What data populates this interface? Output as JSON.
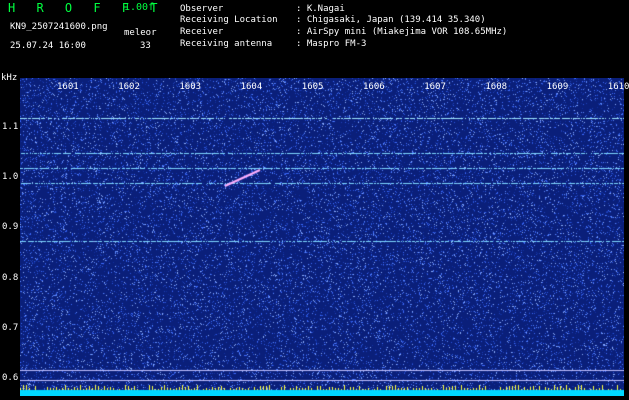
{
  "header": {
    "app_name": "H R O F F T",
    "version": "1.00f",
    "filename": "KN9_2507241600.png",
    "datetime": "25.07.24 16:00",
    "category_label": "meleor",
    "count": "33",
    "observer_label": "Observer",
    "observer_value": ": K.Nagai",
    "location_label": "Receiving Location",
    "location_value": ": Chigasaki, Japan (139.414 35.340)",
    "receiver_label": "Receiver",
    "receiver_value": ": AirSpy mini (Miakejima VOR 108.65MHz)",
    "antenna_label": "Receiving antenna",
    "antenna_value": ": Maspro FM-3"
  },
  "chart_data": {
    "type": "heatmap",
    "y_unit": "kHz",
    "yticks": [
      "1.1",
      "1.0",
      "0.9",
      "0.8",
      "0.7",
      "0.6"
    ],
    "xticks": [
      "1601",
      "1602",
      "1603",
      "1604",
      "1605",
      "1606",
      "1607",
      "1608",
      "1609",
      "1610"
    ],
    "horizontal_lines_khz": [
      1.12,
      1.05,
      1.02,
      0.99,
      0.875
    ],
    "colors": {
      "background": "#0a1f7a",
      "noise_light": "#4a78ff",
      "line": "#7fd8ff",
      "bottom_band": "#00d8ff"
    }
  }
}
